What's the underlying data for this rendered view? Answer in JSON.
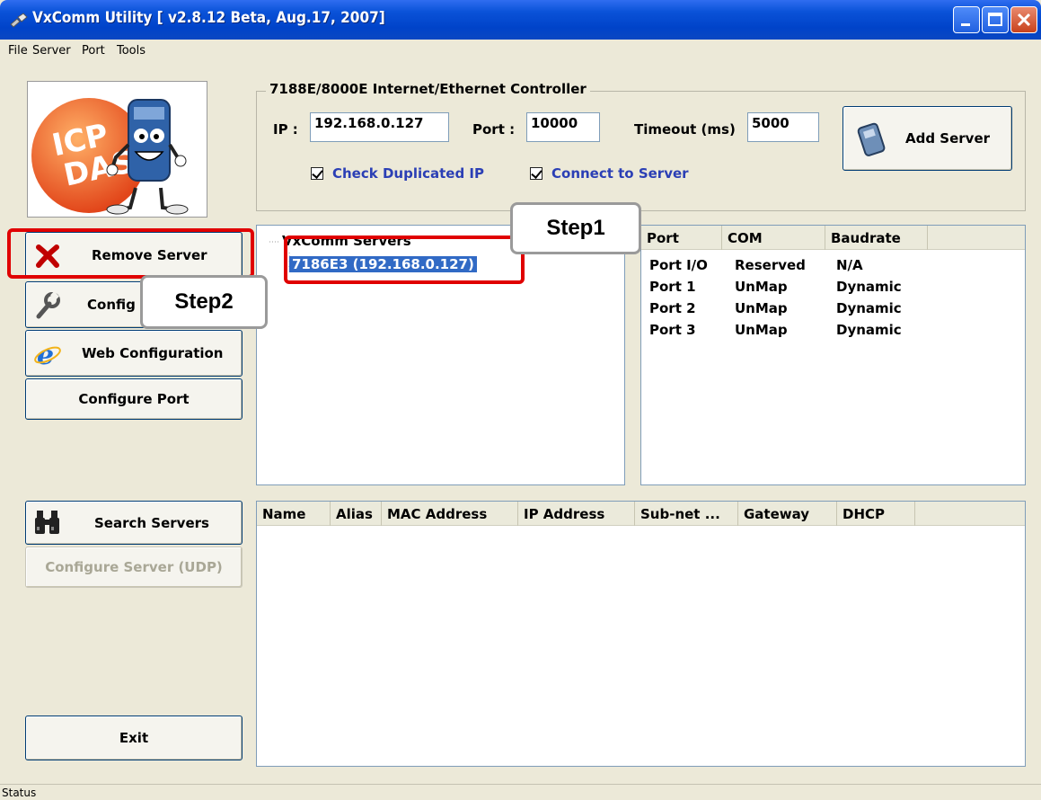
{
  "window": {
    "title": "VxComm Utility [ v2.8.12 Beta, Aug.17, 2007]"
  },
  "menu": [
    "File",
    "Server",
    "Port",
    "Tools"
  ],
  "controller": {
    "legend": "7188E/8000E Internet/Ethernet Controller",
    "ip_label": "IP :",
    "ip_value": "192.168.0.127",
    "port_label": "Port :",
    "port_value": "10000",
    "timeout_label": "Timeout (ms)",
    "timeout_value": "5000",
    "check_duplicated_ip": "Check Duplicated IP",
    "connect_to_server": "Connect to Server",
    "add_server": "Add Server"
  },
  "logo": {
    "text_line1": "ICP",
    "text_line2": "DAS"
  },
  "buttons": {
    "remove_server": "Remove Server",
    "configure_server": "Config",
    "web_configuration": "Web Configuration",
    "configure_port": "Configure Port",
    "search_servers": "Search Servers",
    "configure_server_udp": "Configure Server (UDP)",
    "exit": "Exit"
  },
  "tree": {
    "root": "VxComm Servers",
    "selected_item": "7186E3 (192.168.0.127)"
  },
  "port_table": {
    "headers": [
      "Port",
      "COM",
      "Baudrate"
    ],
    "rows": [
      [
        "Port I/O",
        "Reserved",
        "N/A"
      ],
      [
        "Port 1",
        "UnMap",
        "Dynamic"
      ],
      [
        "Port 2",
        "UnMap",
        "Dynamic"
      ],
      [
        "Port 3",
        "UnMap",
        "Dynamic"
      ]
    ]
  },
  "search_table": {
    "headers": [
      "Name",
      "Alias",
      "MAC Address",
      "IP Address",
      "Sub-net ...",
      "Gateway",
      "DHCP"
    ]
  },
  "callouts": {
    "step1": "Step1",
    "step2": "Step2"
  },
  "status": "Status",
  "colors": {
    "title_blue": "#0a52d8",
    "highlight_red": "#e00000",
    "selection": "#316ac5"
  }
}
